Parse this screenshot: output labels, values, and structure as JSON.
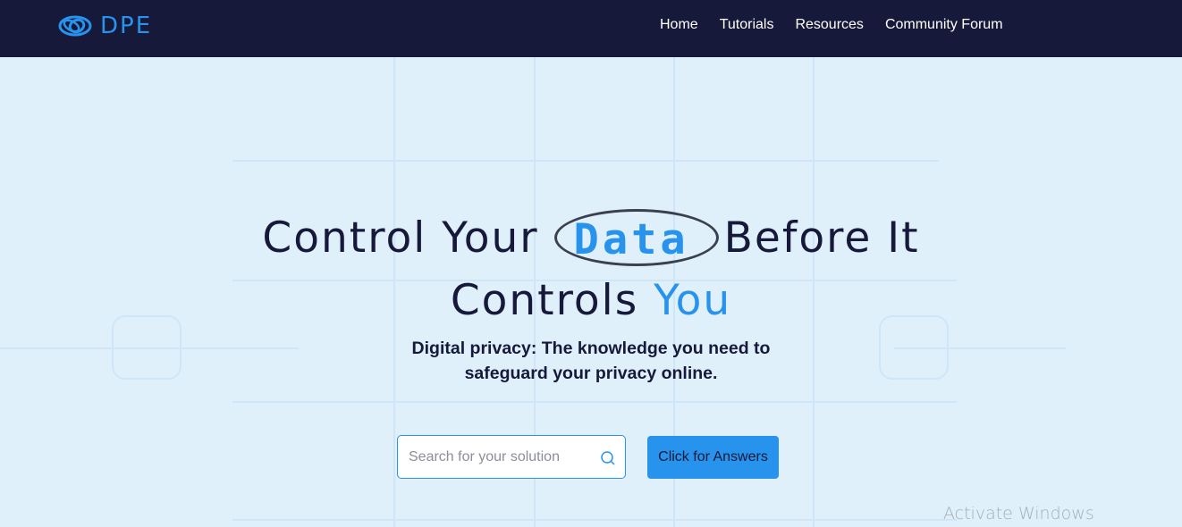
{
  "brand": {
    "name": "DPE",
    "icon": "logo-rings-icon",
    "accent": "#2793ec"
  },
  "nav": {
    "items": [
      {
        "label": "Home"
      },
      {
        "label": "Tutorials"
      },
      {
        "label": "Resources"
      },
      {
        "label": "Community Forum"
      }
    ]
  },
  "hero": {
    "headline_part1": "Control Your",
    "headline_highlight": "Data",
    "headline_part2": "Before It",
    "headline_line2": "Controls",
    "headline_accent": "You",
    "subtitle_line1": "Digital privacy: The knowledge you need to",
    "subtitle_line2": "safeguard your privacy online.",
    "search_placeholder": "Search for your solution",
    "search_value": "",
    "cta_label": "Click for Answers"
  },
  "overlay": {
    "watermark": "Activate Windows"
  },
  "colors": {
    "navbar": "#16193a",
    "background": "#dff0fb",
    "primary": "#2793ec",
    "text": "#16193a"
  }
}
